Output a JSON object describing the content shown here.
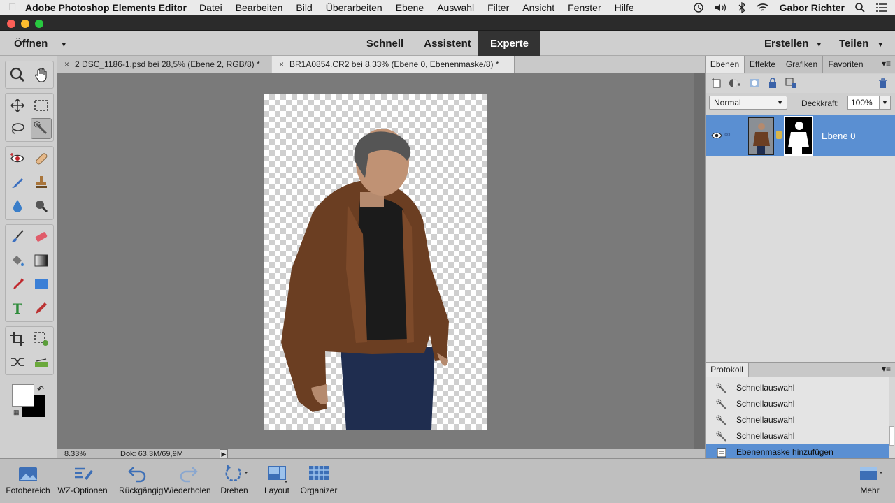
{
  "mac_menu": {
    "app_name": "Adobe Photoshop Elements Editor",
    "items": [
      "Datei",
      "Bearbeiten",
      "Bild",
      "Überarbeiten",
      "Ebene",
      "Auswahl",
      "Filter",
      "Ansicht",
      "Fenster",
      "Hilfe"
    ],
    "user": "Gabor Richter"
  },
  "menubar": {
    "open_label": "Öffnen",
    "modes": [
      "Schnell",
      "Assistent",
      "Experte"
    ],
    "active_mode": "Experte",
    "create_label": "Erstellen",
    "share_label": "Teilen"
  },
  "tabs": [
    {
      "label": "2 DSC_1186-1.psd bei 28,5% (Ebene 2, RGB/8) *"
    },
    {
      "label": "BR1A0854.CR2 bei 8,33% (Ebene 0, Ebenenmaske/8) *"
    }
  ],
  "status": {
    "zoom": "8.33%",
    "doc_size": "Dok: 63,3M/69,9M"
  },
  "panel": {
    "tabs": [
      "Ebenen",
      "Effekte",
      "Grafiken",
      "Favoriten"
    ],
    "blend_mode": "Normal",
    "opacity_label": "Deckkraft:",
    "opacity_value": "100%",
    "layer_name": "Ebene 0"
  },
  "history": {
    "title": "Protokoll",
    "items": [
      "Schnellauswahl",
      "Schnellauswahl",
      "Schnellauswahl",
      "Schnellauswahl",
      "Ebenenmaske hinzufügen"
    ]
  },
  "bottombar": {
    "items": [
      "Fotobereich",
      "WZ-Optionen",
      "Rückgängig",
      "Wiederholen",
      "Drehen",
      "Layout",
      "Organizer"
    ],
    "more": "Mehr"
  },
  "colors": {
    "accent": "#5a8fd2",
    "mode_active_bg": "#333333"
  }
}
